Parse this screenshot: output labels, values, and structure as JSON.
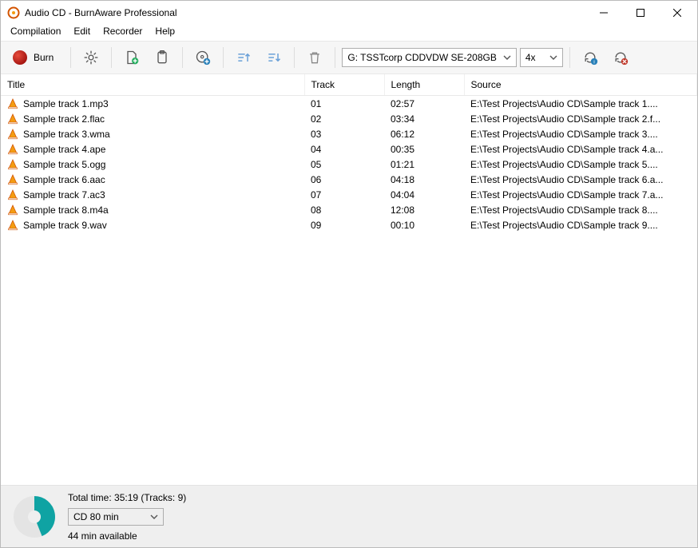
{
  "window": {
    "title": "Audio CD - BurnAware Professional"
  },
  "menu": {
    "items": [
      "Compilation",
      "Edit",
      "Recorder",
      "Help"
    ]
  },
  "toolbar": {
    "burn_label": "Burn",
    "drive": "G: TSSTcorp CDDVDW SE-208GB",
    "speed": "4x"
  },
  "columns": {
    "title": "Title",
    "track": "Track",
    "length": "Length",
    "source": "Source"
  },
  "tracks": [
    {
      "title": "Sample track 1.mp3",
      "track": "01",
      "length": "02:57",
      "source": "E:\\Test Projects\\Audio CD\\Sample track 1...."
    },
    {
      "title": "Sample track 2.flac",
      "track": "02",
      "length": "03:34",
      "source": "E:\\Test Projects\\Audio CD\\Sample track 2.f..."
    },
    {
      "title": "Sample track 3.wma",
      "track": "03",
      "length": "06:12",
      "source": "E:\\Test Projects\\Audio CD\\Sample track 3...."
    },
    {
      "title": "Sample track 4.ape",
      "track": "04",
      "length": "00:35",
      "source": "E:\\Test Projects\\Audio CD\\Sample track 4.a..."
    },
    {
      "title": "Sample track 5.ogg",
      "track": "05",
      "length": "01:21",
      "source": "E:\\Test Projects\\Audio CD\\Sample track 5...."
    },
    {
      "title": "Sample track 6.aac",
      "track": "06",
      "length": "04:18",
      "source": "E:\\Test Projects\\Audio CD\\Sample track 6.a..."
    },
    {
      "title": "Sample track 7.ac3",
      "track": "07",
      "length": "04:04",
      "source": "E:\\Test Projects\\Audio CD\\Sample track 7.a..."
    },
    {
      "title": "Sample track 8.m4a",
      "track": "08",
      "length": "12:08",
      "source": "E:\\Test Projects\\Audio CD\\Sample track 8...."
    },
    {
      "title": "Sample track 9.wav",
      "track": "09",
      "length": "00:10",
      "source": "E:\\Test Projects\\Audio CD\\Sample track 9...."
    }
  ],
  "footer": {
    "total_time": "Total time: 35:19 (Tracks: 9)",
    "media": "CD 80 min",
    "available": "44 min available",
    "used_fraction": 0.44
  }
}
